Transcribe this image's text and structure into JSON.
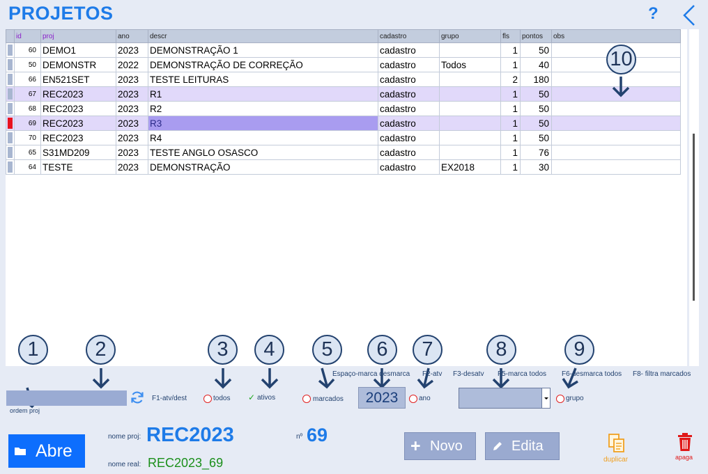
{
  "title": "PROJETOS",
  "help_label": "?",
  "table": {
    "columns": [
      "id",
      "proj",
      "ano",
      "descr",
      "cadastro",
      "grupo",
      "fls",
      "pontos",
      "obs"
    ],
    "rows": [
      {
        "id": "60",
        "proj": "DEMO1",
        "ano": "2023",
        "descr": "DEMONSTRAÇÃO 1",
        "cadastro": "cadastro",
        "grupo": "",
        "fls": "1",
        "pontos": "50",
        "obs": ""
      },
      {
        "id": "50",
        "proj": "DEMONSTR",
        "ano": "2022",
        "descr": "DEMONSTRAÇÃO DE CORREÇÃO",
        "cadastro": "cadastro",
        "grupo": "Todos",
        "fls": "1",
        "pontos": "40",
        "obs": ""
      },
      {
        "id": "66",
        "proj": "EN521SET",
        "ano": "2023",
        "descr": "TESTE LEITURAS",
        "cadastro": "cadastro",
        "grupo": "",
        "fls": "2",
        "pontos": "180",
        "obs": ""
      },
      {
        "id": "67",
        "proj": "REC2023",
        "ano": "2023",
        "descr": "R1",
        "cadastro": "cadastro",
        "grupo": "",
        "fls": "1",
        "pontos": "50",
        "obs": "",
        "highlight": true
      },
      {
        "id": "68",
        "proj": "REC2023",
        "ano": "2023",
        "descr": "R2",
        "cadastro": "cadastro",
        "grupo": "",
        "fls": "1",
        "pontos": "50",
        "obs": ""
      },
      {
        "id": "69",
        "proj": "REC2023",
        "ano": "2023",
        "descr": "R3",
        "cadastro": "cadastro",
        "grupo": "",
        "fls": "1",
        "pontos": "50",
        "obs": "",
        "highlight": true,
        "current": true
      },
      {
        "id": "70",
        "proj": "REC2023",
        "ano": "2023",
        "descr": "R4",
        "cadastro": "cadastro",
        "grupo": "",
        "fls": "1",
        "pontos": "50",
        "obs": ""
      },
      {
        "id": "65",
        "proj": "S31MD209",
        "ano": "2023",
        "descr": "TESTE ANGLO OSASCO",
        "cadastro": "cadastro",
        "grupo": "",
        "fls": "1",
        "pontos": "76",
        "obs": ""
      },
      {
        "id": "64",
        "proj": "TESTE",
        "ano": "2023",
        "descr": "DEMONSTRAÇÃO",
        "cadastro": "cadastro",
        "grupo": "EX2018",
        "fls": "1",
        "pontos": "30",
        "obs": ""
      }
    ]
  },
  "callouts": [
    "1",
    "2",
    "3",
    "4",
    "5",
    "6",
    "7",
    "8",
    "9",
    "10"
  ],
  "filters": {
    "order_label": "ordem proj",
    "search_value": "",
    "f1_hint": "F1-atv/dest",
    "todos_label": "todos",
    "ativos_label": "ativos",
    "marcados_label": "marcados",
    "year_value": "2023",
    "ano_label": "ano",
    "grupo_label": "grupo",
    "group_value": ""
  },
  "shortcuts": {
    "space": "Espaço-marca desmarca",
    "f2": "F2-atv",
    "f3": "F3-desatv",
    "f5": "F5-marca todos",
    "f6": "F6-desmarca todos",
    "f8": "F8- filtra marcados"
  },
  "footer": {
    "open_label": "Abre",
    "proj_name_label": "nome proj:",
    "proj_name_value": "REC2023",
    "real_name_label": "nome real:",
    "real_name_value": "REC2023_69",
    "num_label": "nº",
    "num_value": "69",
    "new_label": "Novo",
    "edit_label": "Edita",
    "duplicate_label": "duplicar",
    "delete_label": "apaga"
  },
  "colors": {
    "accent": "#1e7be8",
    "open_button": "#0d6efd",
    "row_highlight": "#e1d9fa",
    "cell_selected": "#a99cf0",
    "record_indicator": "#e8121f",
    "duplicate_icon": "#f0a020",
    "delete_icon": "#e01818"
  },
  "icons": {
    "help": "question-mark",
    "back": "chevron-left-icon",
    "refresh": "refresh-icon",
    "open": "folder-icon",
    "new": "plus-icon",
    "edit": "pencil-icon",
    "duplicate": "copy-icon",
    "delete": "trash-icon"
  }
}
